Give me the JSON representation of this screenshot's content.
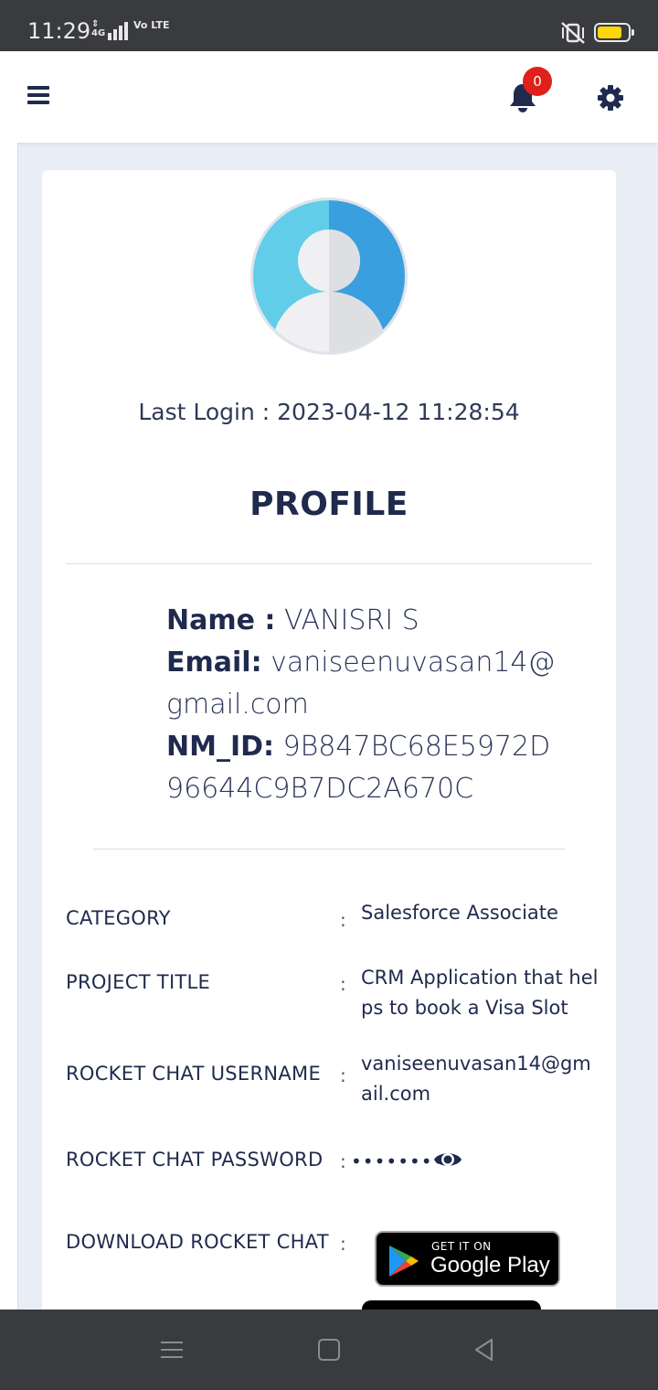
{
  "status_bar": {
    "time": "11:29",
    "network": "4G",
    "volte": "Vo LTE",
    "battery_color": "#ffd60a"
  },
  "app_bar": {
    "menu_icon": "hamburger-icon",
    "notification_icon": "bell-icon",
    "notification_count": "0",
    "settings_icon": "gear-icon",
    "brand_color": "#1f2a4d",
    "badge_color": "#e0201a"
  },
  "profile": {
    "avatar_icon": "user-avatar-icon",
    "last_login_label": "Last Login :",
    "last_login_value": "2023-04-12 11:28:54",
    "title": "PROFILE",
    "name_label": "Name :",
    "name_value": "VANISRI S",
    "email_label": "Email:",
    "email_value": "vaniseenuvasan14@gmail.com",
    "nm_id_label": "NM_ID:",
    "nm_id_value": "9B847BC68E5972D96644C9B7DC2A670C"
  },
  "details": [
    {
      "label": "CATEGORY",
      "value": "Salesforce Associate"
    },
    {
      "label": "PROJECT TITLE",
      "value": "CRM Application that helps to book a Visa Slot"
    },
    {
      "label": "ROCKET CHAT USERNAME",
      "value": "vaniseenuvasan14@gmail.com"
    },
    {
      "label": "ROCKET CHAT PASSWORD",
      "value": "•••••••••"
    },
    {
      "label": "DOWNLOAD ROCKET CHAT",
      "value": ""
    }
  ],
  "colon": ":",
  "password_toggle_icon": "eye-icon",
  "google_play": {
    "small_text": "GET IT ON",
    "big_text": "Google Play",
    "icon": "google-play-icon"
  },
  "nav_bar": {
    "menu_icon": "recent-apps-icon",
    "home_icon": "home-icon",
    "back_icon": "back-icon"
  }
}
